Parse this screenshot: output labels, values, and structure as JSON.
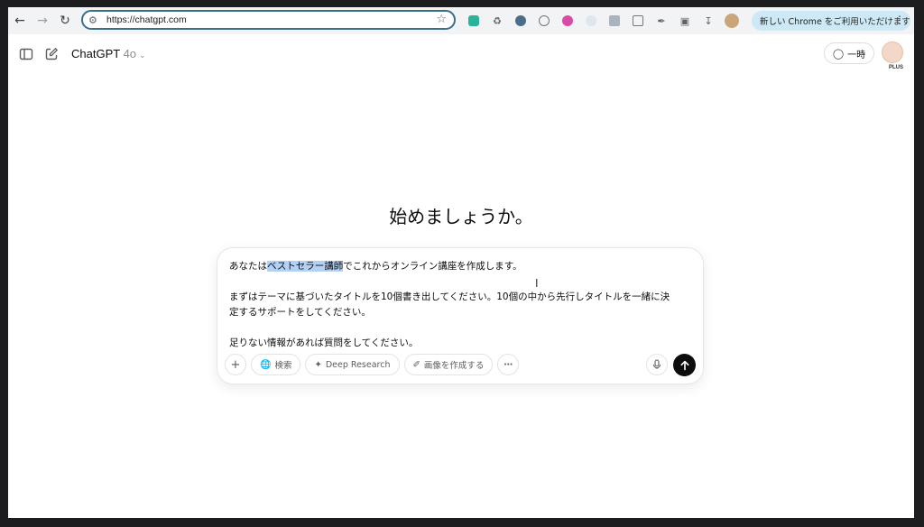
{
  "browser": {
    "url": "https://chatgpt.com",
    "chrome_notice": "新しい Chrome をご利用いただけます"
  },
  "header": {
    "model_name": "ChatGPT",
    "model_version": "4o",
    "temporary_label": "一時",
    "plan_badge": "PLUS"
  },
  "main": {
    "heading": "始めましょうか。"
  },
  "composer": {
    "line1_before": "あなたは",
    "line1_highlight": "ベストセラー講師",
    "line1_after": "でこれからオンライン講座を作成します。",
    "line2a": "まずはテーマに基づいたタイトルを10個書き出してください。10個の中から先行しタイトルを一緒に決",
    "line2b": "定するサポートをしてください。",
    "line3": "足りない情報があれば質問をしてください。",
    "search_label": "検索",
    "deep_research_label": "Deep Research",
    "image_label": "画像を作成する"
  },
  "colors": {
    "highlight": "#b3d1f5",
    "omnibox_border": "#3a6e8c",
    "chrome_notice_bg": "#cde9f6",
    "send_button": "#0d0d0d"
  },
  "icons": [
    "back-icon",
    "forward-icon",
    "reload-icon",
    "site-settings-icon",
    "bookmark-star-icon",
    "download-icon",
    "kebab-menu-icon",
    "sidebar-toggle-icon",
    "new-chat-icon",
    "temporary-chat-icon",
    "plus-icon",
    "globe-icon",
    "telescope-icon",
    "image-brush-icon",
    "ellipsis-icon",
    "mic-icon",
    "send-arrow-icon"
  ]
}
